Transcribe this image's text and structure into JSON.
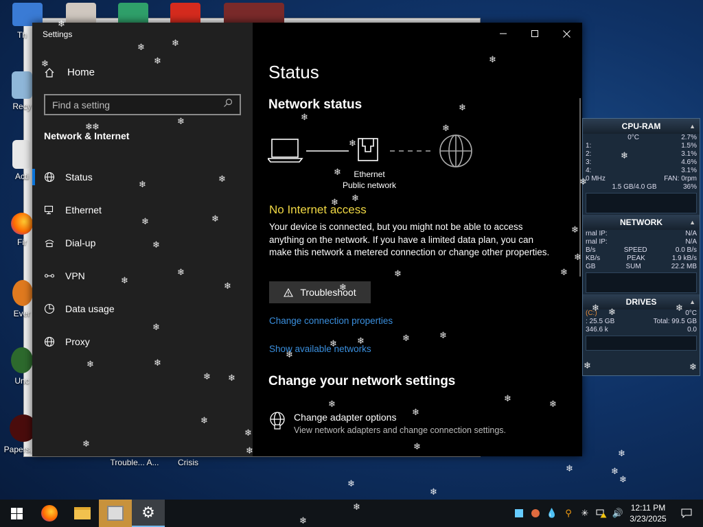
{
  "desktop": {
    "icons": [
      {
        "label": "Th",
        "name": "desktop-icon-this-pc"
      },
      {
        "label": "Recy",
        "name": "desktop-icon-recycle-bin"
      },
      {
        "label": "Acti",
        "name": "desktop-icon-activate"
      },
      {
        "label": "Fir",
        "name": "desktop-icon-firefox"
      },
      {
        "label": "Ever",
        "name": "desktop-icon-everything"
      },
      {
        "label": "Unc",
        "name": "desktop-icon-uncharted"
      },
      {
        "label": "Papers, P",
        "name": "desktop-icon-papers-please"
      }
    ],
    "bottom_labels": {
      "trouble": "Trouble... A...",
      "crisis": "Crisis"
    }
  },
  "settings": {
    "title": "Settings",
    "nav": {
      "home": "Home",
      "search_placeholder": "Find a setting",
      "section": "Network & Internet",
      "items": [
        {
          "label": "Status",
          "icon": "globe-icon",
          "active": true
        },
        {
          "label": "Ethernet",
          "icon": "ethernet-icon"
        },
        {
          "label": "Dial-up",
          "icon": "dialup-icon"
        },
        {
          "label": "VPN",
          "icon": "vpn-icon"
        },
        {
          "label": "Data usage",
          "icon": "data-usage-icon"
        },
        {
          "label": "Proxy",
          "icon": "globe-icon"
        }
      ]
    },
    "content": {
      "heading": "Status",
      "network_status": "Network status",
      "ethernet_name": "Ethernet",
      "network_profile": "Public network",
      "connection_state": "No Internet access",
      "description": "Your device is connected, but you might not be able to access anything on the network. If you have a limited data plan, you can make this network a metered connection or change other properties.",
      "troubleshoot": "Troubleshoot",
      "links": {
        "change_connection": "Change connection properties",
        "show_networks": "Show available networks"
      },
      "change_heading": "Change your network settings",
      "adapter_title": "Change adapter options",
      "adapter_desc": "View network adapters and change connection settings."
    }
  },
  "gadget": {
    "cpu_title": "CPU-RAM",
    "temp": "0°C",
    "cpu_total": "2.7%",
    "cores": [
      {
        "label": "1:",
        "value": "1.5%"
      },
      {
        "label": "2:",
        "value": "3.1%"
      },
      {
        "label": "3:",
        "value": "4.6%"
      },
      {
        "label": "4:",
        "value": "3.1%"
      }
    ],
    "freq": "0 MHz",
    "fan": "FAN: 0rpm",
    "ram": "1.5 GB/4.0 GB",
    "ram_pct": "36%",
    "network_title": "NETWORK",
    "ip_rows": [
      {
        "label": "rnal IP:",
        "value": "N/A"
      },
      {
        "label": "rnal IP:",
        "value": "N/A"
      }
    ],
    "speed": {
      "left": "B/s",
      "label": "SPEED",
      "value": "0.0 B/s"
    },
    "peak": {
      "left": "KB/s",
      "label": "PEAK",
      "value": "1.9 kB/s"
    },
    "sum": {
      "left": "GB",
      "label": "SUM",
      "value": "22.2 MB"
    },
    "drives_title": "DRIVES",
    "drive_label": "(C:)",
    "drive_temp": "0°C",
    "drive_free": ": 25.5 GB",
    "drive_total": "Total: 99.5 GB",
    "drive_io_left": "346.6 k",
    "drive_io_right": "0.0"
  },
  "taskbar": {
    "time": "12:11 PM",
    "date": "3/23/2025"
  }
}
